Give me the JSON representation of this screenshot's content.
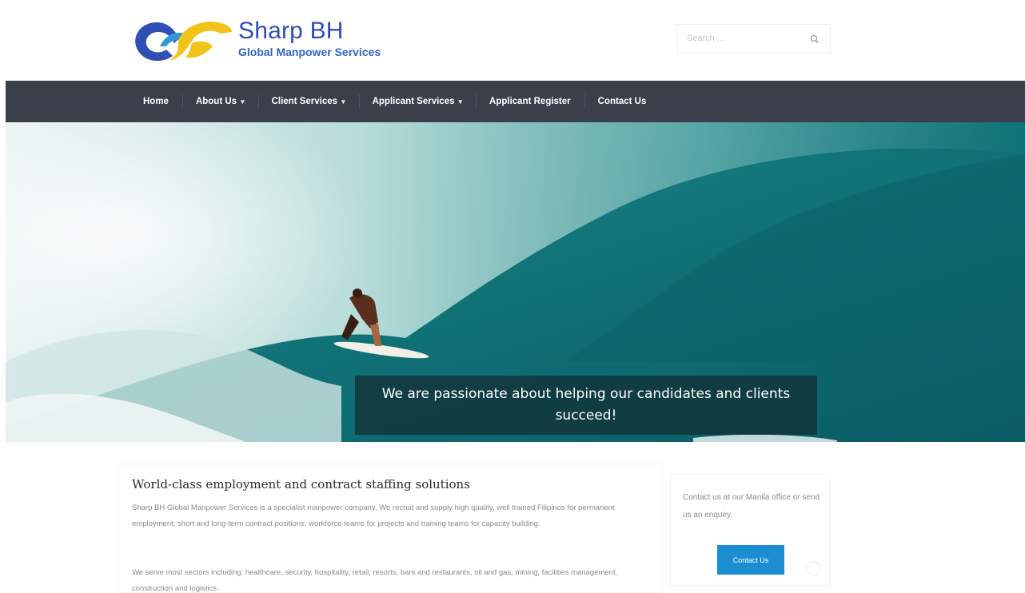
{
  "header": {
    "logo_title": "Sharp BH",
    "logo_subtitle": "Global Manpower Services",
    "logo_icon": "infinity-swoosh-logo",
    "search": {
      "placeholder": "Search ...",
      "icon": "search-icon"
    }
  },
  "nav": {
    "items": [
      {
        "label": "Home",
        "has_dropdown": false
      },
      {
        "label": "About Us",
        "has_dropdown": true
      },
      {
        "label": "Client Services",
        "has_dropdown": true
      },
      {
        "label": "Applicant Services",
        "has_dropdown": true
      },
      {
        "label": "Applicant Register",
        "has_dropdown": false
      },
      {
        "label": "Contact Us",
        "has_dropdown": false
      }
    ],
    "caret": "▾"
  },
  "hero": {
    "caption": "We are passionate about helping our candidates and clients succeed!"
  },
  "main": {
    "heading": "World-class employment and contract staffing solutions",
    "paragraph1": "Sharp BH Global Manpower Services is a specialist manpower company. We recruit and supply high quality, well trained Filipinos for permanent employment, short and long-term contract positions, workforce teams for projects and training teams for capacity building.",
    "paragraph2": "We serve most sectors including: healthcare, security, hospitality, retail, resorts, bars and restaurants, oil and gas, mining, facilities management, construction and logistics."
  },
  "sidebar": {
    "text": "Contact us at our Manila office or send us an enquiry.",
    "button_label": "Contact Us"
  },
  "colors": {
    "nav_bg": "#3b3f4c",
    "brand_blue": "#2f4fb5",
    "brand_yellow": "#f2c318",
    "button_blue": "#1a8ed1"
  }
}
